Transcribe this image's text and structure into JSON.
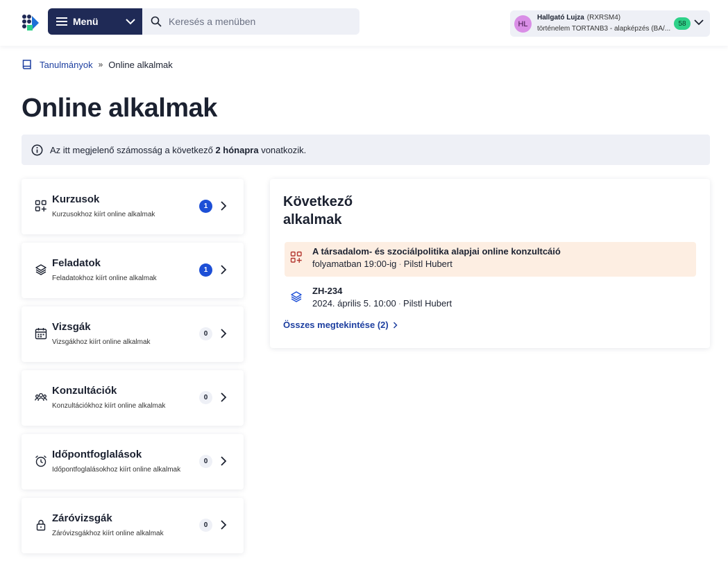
{
  "header": {
    "menu_label": "Menü",
    "search_placeholder": "Keresés a menüben",
    "user": {
      "initials": "HL",
      "name": "Hallgató Lujza",
      "code": "(RXRSM4)",
      "program": "történelem TORTANB3 - alapképzés (BA/...",
      "badge": "58"
    }
  },
  "breadcrumb": {
    "parent": "Tanulmányok",
    "separator": "»",
    "current": "Online alkalmak"
  },
  "page_title": "Online alkalmak",
  "info": {
    "text_before": "Az itt megjelenő számosság a következő ",
    "highlight": "2 hónapra",
    "text_after": " vonatkozik."
  },
  "categories": [
    {
      "title": "Kurzusok",
      "subtitle": "Kurzusokhoz kiírt online alkalmak",
      "count": "1",
      "icon": "grid-plus-icon"
    },
    {
      "title": "Feladatok",
      "subtitle": "Feladatokhoz kiírt online alkalmak",
      "count": "1",
      "icon": "layers-icon"
    },
    {
      "title": "Vizsgák",
      "subtitle": "Vizsgákhoz kiírt online alkalmak",
      "count": "0",
      "icon": "calendar-icon"
    },
    {
      "title": "Konzultációk",
      "subtitle": "Konzultációkhoz kiírt online alkalmak",
      "count": "0",
      "icon": "people-icon"
    },
    {
      "title": "Időpontfoglalások",
      "subtitle": "Időpontfoglalásokhoz kiírt online alkalmak",
      "count": "0",
      "icon": "alarm-clock-icon"
    },
    {
      "title": "Záróvizsgák",
      "subtitle": "Záróvizsgákhoz kiírt online alkalmak",
      "count": "0",
      "icon": "lock-icon"
    }
  ],
  "next": {
    "title": "Következő alkalmak",
    "events": [
      {
        "title": "A társadalom- és szociálpolitika alapjai online konzultcáió",
        "when": "folyamatban 19:00-ig",
        "sep": "·",
        "who": "Pilstl Hubert",
        "icon": "grid-plus-icon"
      },
      {
        "title": "ZH-234",
        "when": "2024. április 5. 10:00",
        "sep": "·",
        "who": "Pilstl Hubert",
        "icon": "layers-icon"
      }
    ],
    "view_all": "Összes megtekintése (2)"
  },
  "colors": {
    "navy": "#1f2a56",
    "link": "#1d3fa0",
    "count_active": "#1d4fd6",
    "highlight_bg": "#fdeee2",
    "badge_green": "#2ed189",
    "avatar": "#d98ee6"
  }
}
